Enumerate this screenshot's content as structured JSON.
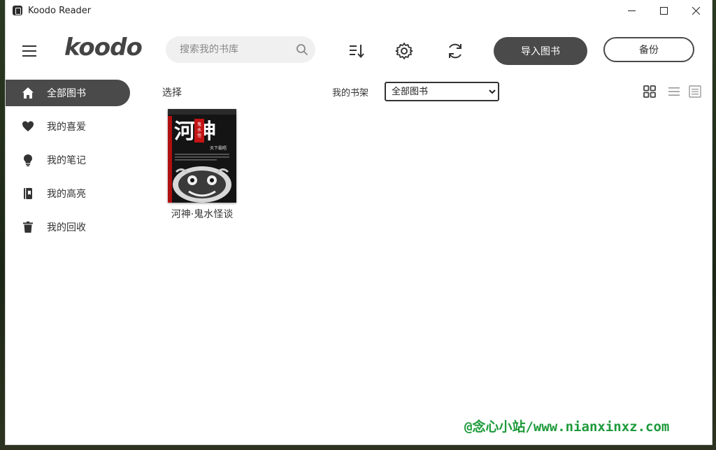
{
  "window": {
    "title": "Koodo Reader"
  },
  "header": {
    "logo_text": "koodo",
    "search": {
      "placeholder": "搜索我的书库",
      "value": ""
    },
    "import_label": "导入图书",
    "backup_label": "备份"
  },
  "sidebar": {
    "items": [
      {
        "label": "全部图书",
        "icon": "home-icon",
        "active": true
      },
      {
        "label": "我的喜爱",
        "icon": "heart-icon",
        "active": false
      },
      {
        "label": "我的笔记",
        "icon": "bulb-icon",
        "active": false
      },
      {
        "label": "我的高亮",
        "icon": "highlight-book-icon",
        "active": false
      },
      {
        "label": "我的回收",
        "icon": "trash-icon",
        "active": false
      }
    ]
  },
  "main": {
    "select_label": "选择",
    "shelf_label": "我的书架",
    "shelf_selected": "全部图书",
    "books": [
      {
        "title": "河神·鬼水怪谈",
        "cover_title": "河神",
        "cover_subtitle": "天下霸唱",
        "cover_tag": "鬼水怪谈"
      }
    ]
  },
  "watermark": "@念心小站/www.nianxinxz.com",
  "colors": {
    "accent_dark": "#4a4a4a",
    "active_bg": "#4a4a4a",
    "search_bg": "#f0f0f0",
    "watermark": "#1d9a3a"
  }
}
